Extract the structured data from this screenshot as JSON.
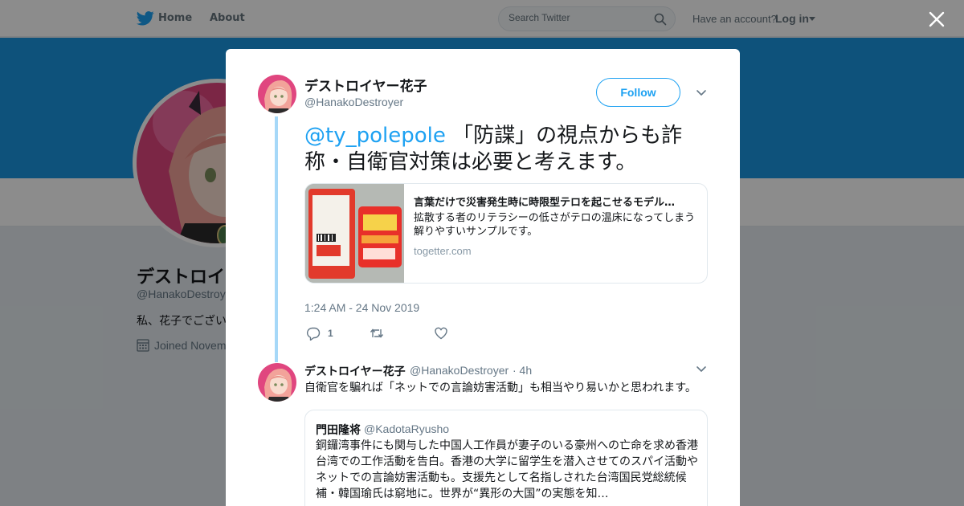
{
  "nav": {
    "home_label": "Home",
    "about_label": "About",
    "search_placeholder": "Search Twitter",
    "have_account": "Have an account?",
    "login_label": "Log in"
  },
  "background_profile": {
    "name": "デストロイ",
    "handle": "@HanakoDestroy",
    "bio": "私、花子でござい",
    "joined": "Joined Novem"
  },
  "tweet": {
    "author_name": "デストロイヤー花子",
    "author_handle": "@HanakoDestroyer",
    "follow_label": "Follow",
    "mention": "@ty_polepole",
    "text": " 「防諜」の視点からも詐称・自衛官対策は必要と考えます。",
    "card": {
      "title": "言葉だけで災害発生時に時限型テロを起こせるモデル…",
      "description": "拡散する者のリテラシーの低さがテロの温床になってしまう解りやすいサンプルです。",
      "domain": "togetter.com"
    },
    "timestamp": "1:24 AM - 24 Nov 2019",
    "reply_count": "1"
  },
  "reply": {
    "author_name": "デストロイヤー花子",
    "author_handle": "@HanakoDestroyer",
    "time": "· 4h",
    "text": "自衛官を騙れば「ネットでの言論妨害活動」も相当やり易いかと思われます。",
    "quote": {
      "name": "門田隆将",
      "handle": "@KadotaRyusho",
      "text": "銅鑼湾事件にも関与した中国人工作員が妻子のいる豪州への亡命を求め香港台湾での工作活動を告白。香港の大学に留学生を潜入させてのスパイ活動やネットでの言論妨害活動も。支援先として名指しされた台湾国民党総統候補・韓国瑜氏は窮地に。世界が“異形の大国”の実態を知…"
    }
  },
  "colors": {
    "accent": "#1da1f2",
    "banner": "#1b95e0",
    "thread_line": "#a6d8f8",
    "muted_text": "#657786"
  },
  "icons": [
    "twitter-bird-icon",
    "search-icon",
    "caret-down-icon",
    "close-icon",
    "chevron-down-icon",
    "reply-icon",
    "retweet-icon",
    "like-icon",
    "calendar-icon"
  ]
}
